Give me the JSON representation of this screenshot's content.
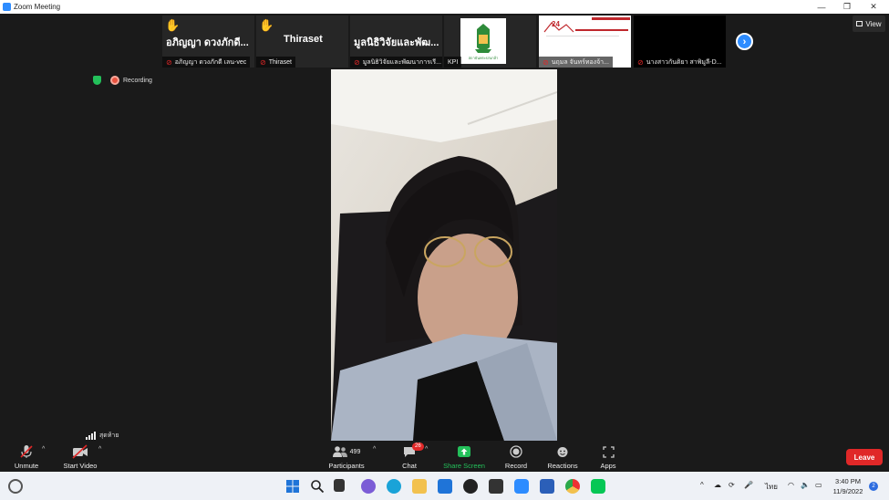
{
  "window": {
    "title": "Zoom Meeting",
    "controls": [
      "—",
      "❐",
      "✕"
    ]
  },
  "thumbnails": [
    {
      "display": "อภิญญา ดวงภักดี...",
      "name": "อภิญญา ดวงภักดี เลน-vec",
      "hand": "✋"
    },
    {
      "display": "Thiraset",
      "name": "Thiraset",
      "hand": "✋"
    },
    {
      "display": "มูลนิธิวิจัยและพัฒ...",
      "name": "มูลนิธิวิจัยและพัฒนาการเรี..."
    },
    {
      "display": "",
      "name": "KPI",
      "logo_caption": "สถาบันพระปกเกล้า"
    },
    {
      "display": "",
      "name": "นฤมล จันทร์ทองจ้า..."
    },
    {
      "display": "",
      "name": "นางสาวกันติยา สาพิมูลี-D..."
    }
  ],
  "view_button": "View",
  "recording": {
    "label": "Recording"
  },
  "network": {
    "label": "สุดท้าย"
  },
  "toolbar": {
    "unmute": "Unmute",
    "start_video": "Start Video",
    "participants": "Participants",
    "participants_count": "499",
    "chat": "Chat",
    "chat_badge": "26",
    "share_screen": "Share Screen",
    "record": "Record",
    "reactions": "Reactions",
    "apps": "Apps",
    "leave": "Leave"
  },
  "taskbar": {
    "language": "ไทย",
    "time": "3:40 PM",
    "date": "11/9/2022",
    "notification_count": "2"
  },
  "colors": {
    "zoom_blue": "#2d8cff",
    "leave_red": "#e02828",
    "share_green": "#23c05a",
    "stage_bg": "#1a1a1a"
  }
}
